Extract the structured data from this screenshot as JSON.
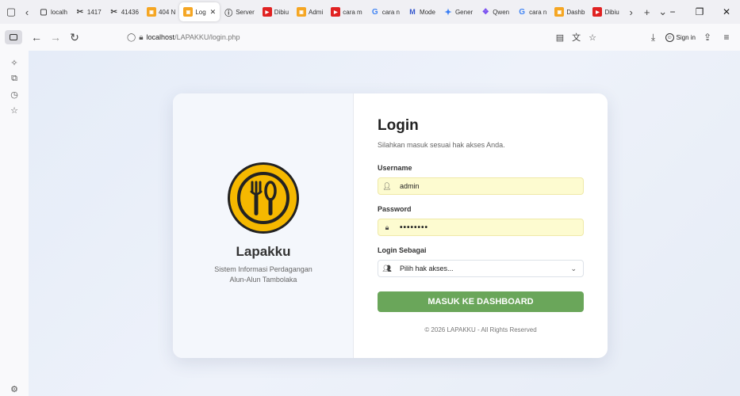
{
  "browser": {
    "tabs": [
      {
        "label": "localh",
        "icon": "doc-icon",
        "active": false
      },
      {
        "label": "1417",
        "icon": "scissors-icon",
        "active": false
      },
      {
        "label": "41436",
        "icon": "scissors-icon",
        "active": false
      },
      {
        "label": "404 N",
        "icon": "box-icon",
        "active": false
      },
      {
        "label": "Log",
        "icon": "box-icon",
        "active": true
      },
      {
        "label": "Server",
        "icon": "info-icon",
        "active": false
      },
      {
        "label": "Dibiu",
        "icon": "youtube-icon",
        "active": false
      },
      {
        "label": "Admi",
        "icon": "box-icon",
        "active": false
      },
      {
        "label": "cara m",
        "icon": "youtube-icon",
        "active": false
      },
      {
        "label": "cara n",
        "icon": "google-icon",
        "active": false
      },
      {
        "label": "Mode",
        "icon": "meta-icon",
        "active": false
      },
      {
        "label": "Gener",
        "icon": "gemini-icon",
        "active": false
      },
      {
        "label": "Qwen",
        "icon": "qwen-icon",
        "active": false
      },
      {
        "label": "cara n",
        "icon": "google-icon",
        "active": false
      },
      {
        "label": "Dashb",
        "icon": "box-icon",
        "active": false
      },
      {
        "label": "Dibiu",
        "icon": "youtube-icon",
        "active": false
      }
    ],
    "url_host": "localhost",
    "url_path": "/LAPAKKU/login.php",
    "signin_label": "Sign in"
  },
  "brand": {
    "name": "Lapakku",
    "tagline_line1": "Sistem Informasi Perdagangan",
    "tagline_line2": "Alun-Alun Tambolaka",
    "logo_color": "#f5b800"
  },
  "login": {
    "title": "Login",
    "subtitle": "Silahkan masuk sesuai hak akses Anda.",
    "username_label": "Username",
    "username_value": "admin",
    "password_label": "Password",
    "password_value": "••••••••",
    "role_label": "Login Sebagai",
    "role_placeholder": "Pilih hak akses...",
    "submit_label": "MASUK KE DASHBOARD",
    "submit_color": "#6aa65a",
    "footer": "© 2026 LAPAKKU - All Rights Reserved"
  }
}
